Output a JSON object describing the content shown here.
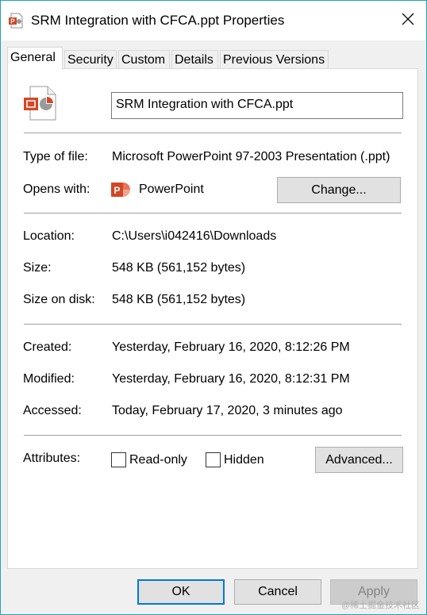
{
  "window": {
    "title": "SRM Integration with CFCA.ppt Properties"
  },
  "tabs": [
    {
      "label": "General",
      "active": true
    },
    {
      "label": "Security",
      "active": false
    },
    {
      "label": "Custom",
      "active": false
    },
    {
      "label": "Details",
      "active": false
    },
    {
      "label": "Previous Versions",
      "active": false
    }
  ],
  "general": {
    "file_name": "SRM Integration with CFCA.ppt",
    "type_label": "Type of file:",
    "type_value": "Microsoft PowerPoint 97-2003 Presentation (.ppt)",
    "opens_label": "Opens with:",
    "opens_value": "PowerPoint",
    "change_button": "Change...",
    "location_label": "Location:",
    "location_value": "C:\\Users\\i042416\\Downloads",
    "size_label": "Size:",
    "size_value": "548 KB (561,152 bytes)",
    "size_on_disk_label": "Size on disk:",
    "size_on_disk_value": "548 KB (561,152 bytes)",
    "created_label": "Created:",
    "created_value": "Yesterday, February 16, 2020, 8:12:26 PM",
    "modified_label": "Modified:",
    "modified_value": "Yesterday, February 16, 2020, 8:12:31 PM",
    "accessed_label": "Accessed:",
    "accessed_value": "Today, February 17, 2020, 3 minutes ago",
    "attributes_label": "Attributes:",
    "readonly_label": "Read-only",
    "readonly_checked": false,
    "hidden_label": "Hidden",
    "hidden_checked": false,
    "advanced_button": "Advanced..."
  },
  "footer": {
    "ok": "OK",
    "cancel": "Cancel",
    "apply": "Apply"
  },
  "watermark": "@稀土掘金技术社区",
  "icons": {
    "title": "ppt-file-icon",
    "close": "close-icon",
    "file": "ppt-document-icon",
    "app": "powerpoint-app-icon"
  },
  "colors": {
    "accent_border": "#1fa3b5",
    "powerpoint_red": "#d24726",
    "ok_border": "#0078d7"
  }
}
